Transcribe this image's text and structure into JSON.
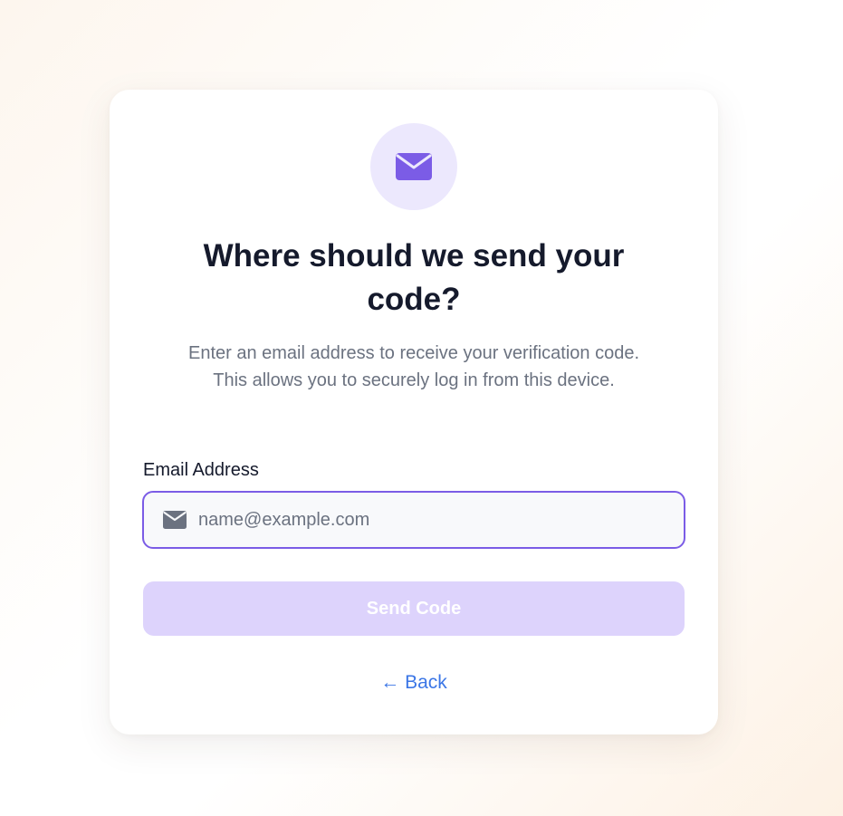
{
  "card": {
    "icon": "envelope-icon",
    "title": "Where should we send your code?",
    "subtitle": "Enter an email address to receive your verification code. This allows you to securely log in from this device."
  },
  "form": {
    "email_label": "Email Address",
    "email_value": "",
    "email_placeholder": "name@example.com",
    "email_icon": "envelope-icon",
    "send_label": "Send Code",
    "send_disabled": true
  },
  "nav": {
    "back_label": "← Back"
  },
  "colors": {
    "accent": "#7b5ce6",
    "icon_bg": "#ece8fd",
    "button_disabled": "#ddd3fc",
    "link": "#3b76e6",
    "title_text": "#151a2c",
    "muted_text": "#6b7280"
  }
}
